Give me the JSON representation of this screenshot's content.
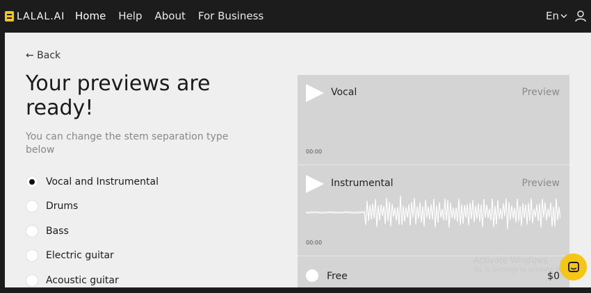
{
  "header": {
    "logo_text": "LALAL.AI",
    "nav": [
      "Home",
      "Help",
      "About",
      "For Business"
    ],
    "language": "En"
  },
  "main": {
    "back_label": "← Back",
    "title": "Your previews are ready!",
    "subtitle": "You can change the stem separation type below",
    "options": [
      {
        "label": "Vocal and Instrumental",
        "selected": true
      },
      {
        "label": "Drums",
        "selected": false
      },
      {
        "label": "Bass",
        "selected": false
      },
      {
        "label": "Electric guitar",
        "selected": false
      },
      {
        "label": "Acoustic guitar",
        "selected": false
      }
    ]
  },
  "player": {
    "tracks": [
      {
        "name": "Vocal",
        "preview_label": "Preview",
        "time": "00:00"
      },
      {
        "name": "Instrumental",
        "preview_label": "Preview",
        "time": "00:00"
      }
    ],
    "plan": {
      "label": "Free",
      "price": "$0"
    }
  },
  "overlay": {
    "watermark_line1": "Activate Windows",
    "watermark_line2": "Go to Settings to activate Windows."
  },
  "colors": {
    "accent": "#f5c518",
    "topbar": "#1c1c1c",
    "page_bg": "#efefef",
    "player_bg": "#d4d4d4"
  }
}
